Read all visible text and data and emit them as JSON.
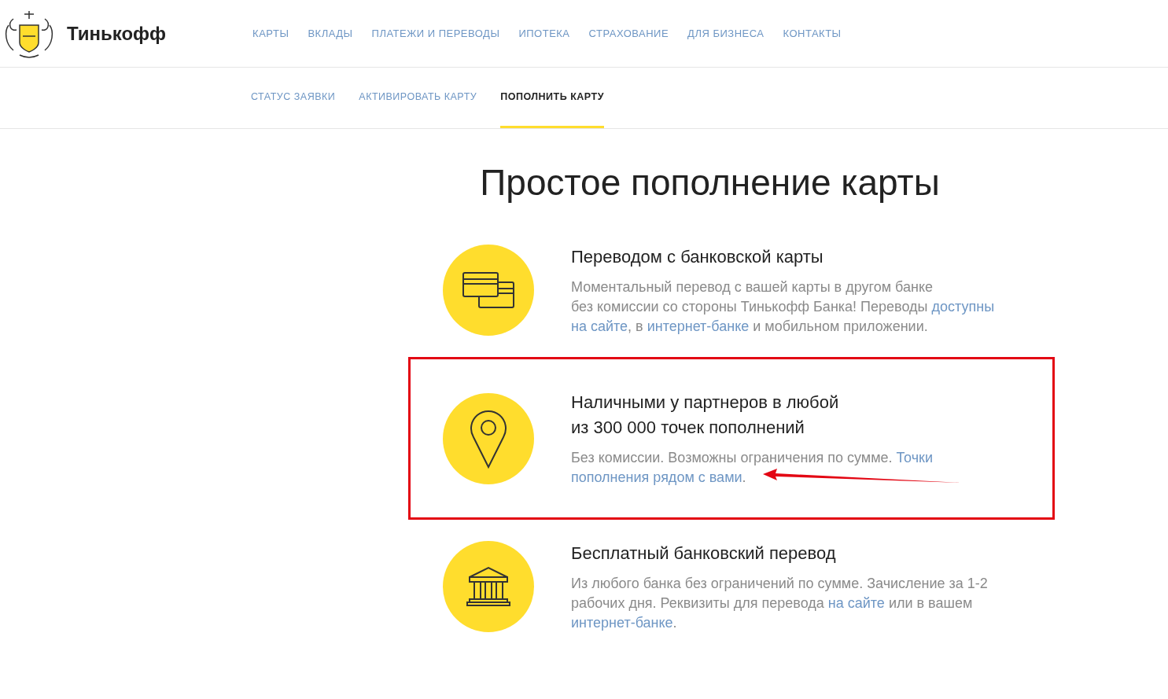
{
  "header": {
    "brand": "Тинькофф",
    "nav": [
      {
        "label": "КАРТЫ"
      },
      {
        "label": "ВКЛАДЫ"
      },
      {
        "label": "ПЛАТЕЖИ И ПЕРЕВОДЫ"
      },
      {
        "label": "ИПОТЕКА"
      },
      {
        "label": "СТРАХОВАНИЕ"
      },
      {
        "label": "ДЛЯ БИЗНЕСА"
      },
      {
        "label": "КОНТАКТЫ"
      }
    ]
  },
  "subnav": [
    {
      "label": "СТАТУС ЗАЯВКИ",
      "selected": false
    },
    {
      "label": "АКТИВИРОВАТЬ КАРТУ",
      "selected": false
    },
    {
      "label": "ПОПОЛНИТЬ КАРТУ",
      "selected": true
    }
  ],
  "title": "Простое пополнение карты",
  "methods": [
    {
      "kind": "cards",
      "highlighted": false,
      "title": [
        "Переводом с банковской карты"
      ],
      "lines": [
        [
          {
            "text": "Моментальный перевод с вашей карты в другом банке",
            "link": false
          }
        ],
        [
          {
            "text": "без комиссии со стороны Тинькофф Банка! Переводы ",
            "link": false
          },
          {
            "text": "доступны",
            "link": true
          }
        ],
        [
          {
            "text": "на сайте",
            "link": true
          },
          {
            "text": ", в ",
            "link": false
          },
          {
            "text": "интернет-банке",
            "link": true
          },
          {
            "text": " и мобильном приложении.",
            "link": false
          }
        ]
      ]
    },
    {
      "kind": "pin",
      "highlighted": true,
      "title": [
        "Наличными у партнеров в любой",
        "из 300 000 точек пополнений"
      ],
      "lines": [
        [
          {
            "text": "Без комиссии. Возможны ограничения по сумме. ",
            "link": false
          },
          {
            "text": "Точки",
            "link": true
          }
        ],
        [
          {
            "text": "пополнения рядом с вами",
            "link": true
          },
          {
            "text": ".",
            "link": false
          }
        ]
      ]
    },
    {
      "kind": "bank",
      "highlighted": false,
      "title": [
        "Бесплатный банковский перевод"
      ],
      "lines": [
        [
          {
            "text": "Из любого банка без ограничений по сумме. Зачисление за 1-2",
            "link": false
          }
        ],
        [
          {
            "text": "рабочих дня. Реквизиты для перевода ",
            "link": false
          },
          {
            "text": "на сайте",
            "link": true
          },
          {
            "text": " или в вашем",
            "link": false
          }
        ],
        [
          {
            "text": "интернет-банке",
            "link": true
          },
          {
            "text": ".",
            "link": false
          }
        ]
      ]
    }
  ]
}
